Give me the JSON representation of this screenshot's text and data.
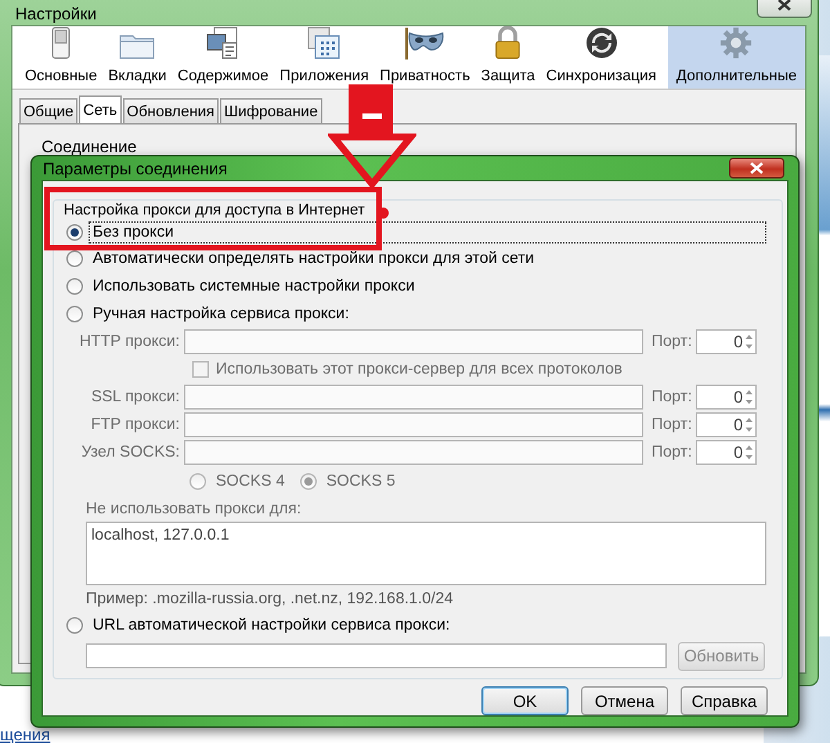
{
  "background_page": {
    "link": "щения"
  },
  "settings_window": {
    "title": "Настройки",
    "toolbar": [
      {
        "label": "Основные",
        "selected": false
      },
      {
        "label": "Вкладки",
        "selected": false
      },
      {
        "label": "Содержимое",
        "selected": false
      },
      {
        "label": "Приложения",
        "selected": false
      },
      {
        "label": "Приватность",
        "selected": false
      },
      {
        "label": "Защита",
        "selected": false
      },
      {
        "label": "Синхронизация",
        "selected": false
      },
      {
        "label": "Дополнительные",
        "selected": true
      }
    ],
    "tabs": [
      {
        "label": "Общие",
        "selected": false
      },
      {
        "label": "Сеть",
        "selected": true
      },
      {
        "label": "Обновления",
        "selected": false
      },
      {
        "label": "Шифрование",
        "selected": false
      }
    ],
    "section_title": "Соединение"
  },
  "dialog": {
    "title": "Параметры соединения",
    "group_title": "Настройка прокси для доступа в Интернет",
    "modes": [
      {
        "label": "Без прокси",
        "selected": true
      },
      {
        "label": "Автоматически определять настройки прокси для этой сети",
        "selected": false
      },
      {
        "label": "Использовать системные настройки прокси",
        "selected": false
      },
      {
        "label": "Ручная настройка сервиса прокси:",
        "selected": false
      }
    ],
    "proxy_rows": [
      {
        "kind": "host",
        "label": "HTTP прокси:",
        "port_label": "Порт:",
        "port": "0",
        "disabled": true
      },
      {
        "kind": "checkbox",
        "label": "Использовать этот прокси-сервер для всех протоколов",
        "checked": false,
        "disabled": true
      },
      {
        "kind": "host",
        "label": "SSL прокси:",
        "port_label": "Порт:",
        "port": "0",
        "disabled": true
      },
      {
        "kind": "host",
        "label": "FTP прокси:",
        "port_label": "Порт:",
        "port": "0",
        "disabled": true
      },
      {
        "kind": "host",
        "label": "Узел SOCKS:",
        "port_label": "Порт:",
        "port": "0",
        "disabled": true
      }
    ],
    "socks_versions": [
      {
        "label": "SOCKS 4",
        "selected": false,
        "disabled": true
      },
      {
        "label": "SOCKS 5",
        "selected": true,
        "disabled": true
      }
    ],
    "no_proxy": {
      "label": "Не использовать прокси для:",
      "value": "localhost, 127.0.0.1",
      "disabled": true
    },
    "example": "Пример: .mozilla-russia.org, .net.nz, 192.168.1.0/24",
    "auto_url": {
      "label": "URL автоматической настройки сервиса прокси:",
      "selected": false,
      "button": "Обновить",
      "disabled": true
    },
    "buttons": [
      {
        "label": "OK",
        "default": true
      },
      {
        "label": "Отмена",
        "default": false
      },
      {
        "label": "Справка",
        "default": false
      }
    ]
  },
  "annotations": [
    {
      "kind": "arrow"
    },
    {
      "kind": "frame"
    }
  ]
}
